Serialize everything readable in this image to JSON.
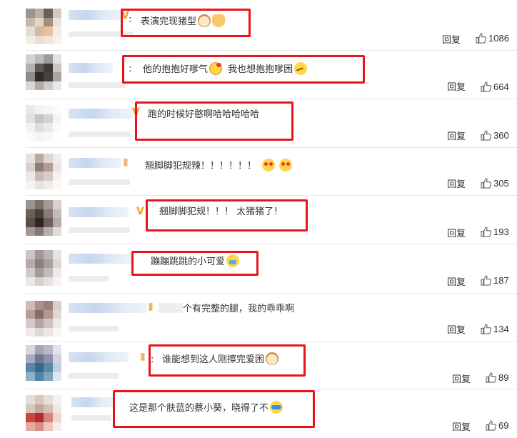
{
  "reply_label": "回复",
  "comments": [
    {
      "text": "表演完现猪型",
      "emojis": [
        "cat-face-icon",
        "thumbs-up-icon"
      ],
      "likes": "1086"
    },
    {
      "text": "他的抱抱好嗲气",
      "emojis": [
        "kiss-face-icon"
      ],
      "text2": "我也想抱抱嗲困",
      "emojis2": [
        "thinking-face-icon"
      ],
      "likes": "664"
    },
    {
      "text": "跑的时候好憨啊哈哈哈哈哈",
      "emojis": [],
      "likes": "360"
    },
    {
      "text": "翘脚脚犯规辣！！！！！！",
      "emojis": [
        "heart-eyes-icon",
        "heart-eyes-icon"
      ],
      "likes": "305"
    },
    {
      "text": "翘脚脚犯规！！！ 太猪猪了！",
      "emojis": [],
      "likes": "193"
    },
    {
      "text": "蹦蹦跳跳的小可爱",
      "emojis": [
        "crying-face-icon"
      ],
      "likes": "187"
    },
    {
      "text": "个有完整的腿，我的乖乖啊",
      "emojis": [],
      "likes": "134"
    },
    {
      "text": "谁能想到这人刚擦完爱困",
      "emojis": [
        "cat-face-icon"
      ],
      "likes": "89"
    },
    {
      "text": "这是那个肤蓝的蔡小葵，晓得了不",
      "emojis": [
        "laughing-tears-icon"
      ],
      "likes": "69"
    }
  ]
}
